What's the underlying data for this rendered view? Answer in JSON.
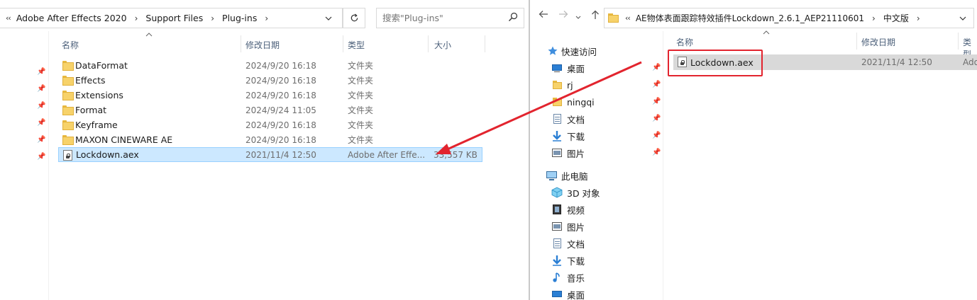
{
  "left": {
    "breadcrumb": [
      "Adobe After Effects 2020",
      "Support Files",
      "Plug-ins"
    ],
    "search_placeholder": "搜索\"Plug-ins\"",
    "columns": {
      "name": "名称",
      "date": "修改日期",
      "type": "类型",
      "size": "大小"
    },
    "files": [
      {
        "name": "DataFormat",
        "date": "2024/9/20 16:18",
        "type": "文件夹",
        "size": "",
        "kind": "folder"
      },
      {
        "name": "Effects",
        "date": "2024/9/20 16:18",
        "type": "文件夹",
        "size": "",
        "kind": "folder"
      },
      {
        "name": "Extensions",
        "date": "2024/9/20 16:18",
        "type": "文件夹",
        "size": "",
        "kind": "folder"
      },
      {
        "name": "Format",
        "date": "2024/9/24 11:05",
        "type": "文件夹",
        "size": "",
        "kind": "folder"
      },
      {
        "name": "Keyframe",
        "date": "2024/9/20 16:18",
        "type": "文件夹",
        "size": "",
        "kind": "folder"
      },
      {
        "name": "MAXON CINEWARE AE",
        "date": "2024/9/20 16:18",
        "type": "文件夹",
        "size": "",
        "kind": "folder"
      },
      {
        "name": "Lockdown.aex",
        "date": "2021/11/4 12:50",
        "type": "Adobe After Effe...",
        "size": "33,557 KB",
        "kind": "file"
      }
    ]
  },
  "right": {
    "breadcrumb": [
      "AE物体表面跟踪特效插件Lockdown_2.6.1_AEP21110601",
      "中文版"
    ],
    "columns": {
      "name": "名称",
      "date": "修改日期",
      "type": "类型"
    },
    "files": [
      {
        "name": "Lockdown.aex",
        "date": "2021/11/4 12:50",
        "type": "Ado"
      }
    ],
    "nav": {
      "quick_access": "快速访问",
      "quick_items": [
        {
          "label": "桌面",
          "icon": "desktop-icon",
          "pinned": true
        },
        {
          "label": "rj",
          "icon": "folder-icon",
          "pinned": true
        },
        {
          "label": "ningqi",
          "icon": "folder-icon",
          "pinned": true
        },
        {
          "label": "文档",
          "icon": "document-icon",
          "pinned": true
        },
        {
          "label": "下载",
          "icon": "download-icon",
          "pinned": true
        },
        {
          "label": "图片",
          "icon": "picture-icon",
          "pinned": true
        }
      ],
      "this_pc": "此电脑",
      "pc_items": [
        {
          "label": "3D 对象",
          "icon": "3d-objects-icon"
        },
        {
          "label": "视频",
          "icon": "video-icon"
        },
        {
          "label": "图片",
          "icon": "picture-icon"
        },
        {
          "label": "文档",
          "icon": "document-icon"
        },
        {
          "label": "下载",
          "icon": "download-icon"
        },
        {
          "label": "音乐",
          "icon": "music-icon"
        },
        {
          "label": "桌面",
          "icon": "desktop-icon"
        }
      ]
    }
  },
  "colors": {
    "selection": "#cce8ff",
    "annotation_red": "#e2242e"
  }
}
